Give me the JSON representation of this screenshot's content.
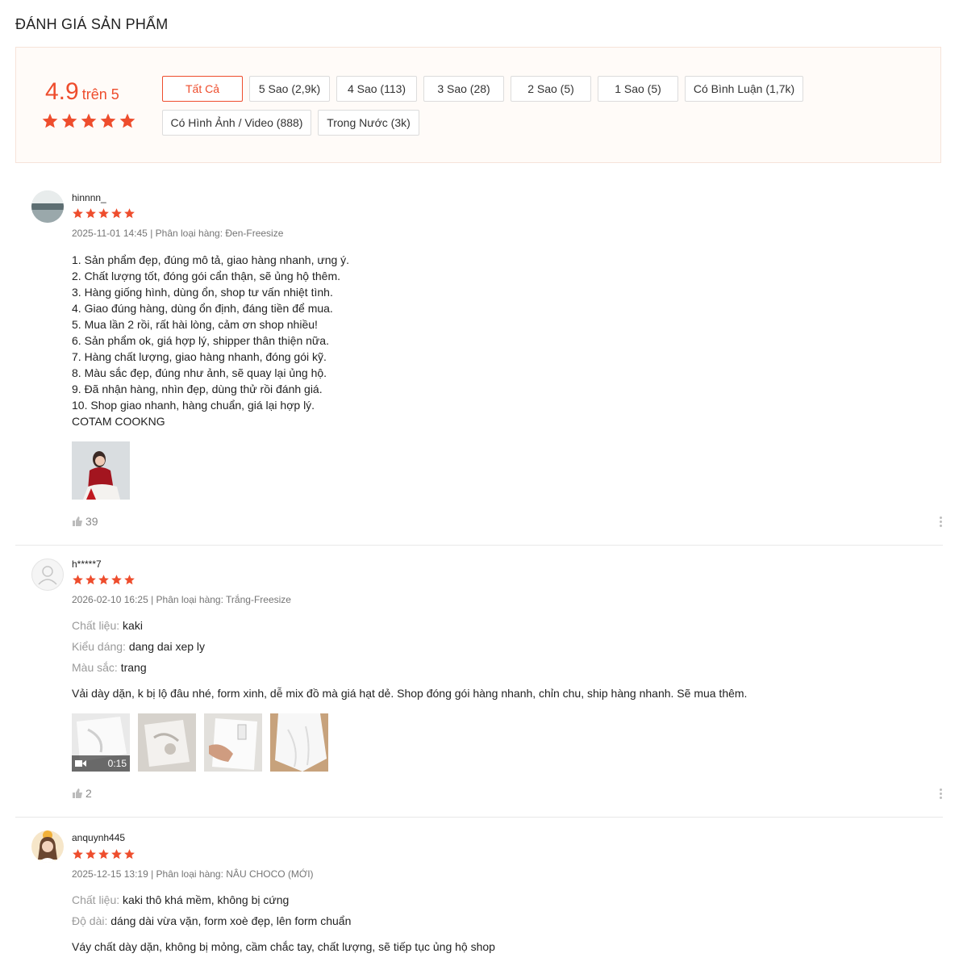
{
  "section_title": "ĐÁNH GIÁ SẢN PHẨM",
  "rating": {
    "score": "4.9",
    "out_of": "trên 5",
    "stars": 5
  },
  "colors": {
    "accent": "#ee4d2d",
    "summary_bg": "#fffbf8"
  },
  "filters": [
    {
      "label": "Tất Cả",
      "active": true
    },
    {
      "label": "5 Sao (2,9k)"
    },
    {
      "label": "4 Sao (113)"
    },
    {
      "label": "3 Sao (28)"
    },
    {
      "label": "2 Sao (5)"
    },
    {
      "label": "1 Sao (5)"
    },
    {
      "label": "Có Bình Luận (1,7k)"
    },
    {
      "label": "Có Hình Ảnh / Video (888)"
    },
    {
      "label": "Trong Nước (3k)"
    }
  ],
  "reviews": [
    {
      "username": "hinnnn_",
      "stars": 5,
      "meta": "2025-11-01 14:45 | Phân loại hàng: Đen-Freesize",
      "lines": [
        "1. Sản phẩm đẹp, đúng mô tả, giao hàng nhanh, ưng ý.",
        "2. Chất lượng tốt, đóng gói cẩn thận, sẽ ủng hộ thêm.",
        "3. Hàng giống hình, dùng ổn, shop tư vấn nhiệt tình.",
        "4. Giao đúng hàng, dùng ổn định, đáng tiền để mua.",
        "5. Mua lần 2 rồi, rất hài lòng, cảm ơn shop nhiều!",
        "6. Sản phẩm ok, giá hợp lý, shipper thân thiện nữa.",
        "7. Hàng chất lượng, giao hàng nhanh, đóng gói kỹ.",
        "8. Màu sắc đẹp, đúng như ảnh, sẽ quay lại ủng hộ.",
        "9. Đã nhận hàng, nhìn đẹp, dùng thử rồi đánh giá.",
        "10. Shop giao nhanh, hàng chuẩn, giá lại hợp lý.",
        "COTAM COOKNG"
      ],
      "likes": "39"
    },
    {
      "username": "h*****7",
      "stars": 5,
      "meta": "2026-02-10 16:25 | Phân loại hàng: Trắng-Freesize",
      "attributes": [
        {
          "key": "Chất liệu:",
          "value": "kaki"
        },
        {
          "key": "Kiểu dáng:",
          "value": "dang dai xep ly"
        },
        {
          "key": "Màu sắc:",
          "value": "trang"
        }
      ],
      "text": "Vải dày dặn, k bị lộ đâu nhé, form xinh, dễ mix đồ mà giá hạt dẻ. Shop đóng gói hàng nhanh, chỉn chu, ship hàng nhanh. Sẽ mua thêm.",
      "video_duration": "0:15",
      "likes": "2"
    },
    {
      "username": "anquynh445",
      "stars": 5,
      "meta": "2025-12-15 13:19 | Phân loại hàng: NÂU CHOCO (MỚI)",
      "attributes": [
        {
          "key": "Chất liệu:",
          "value": "kaki thô khá mềm, không bị cứng"
        },
        {
          "key": "Độ dài:",
          "value": "dáng dài vừa vặn, form xoè đẹp, lên form chuẩn"
        }
      ],
      "text": "Váy chất dày dặn, không bị mỏng, cầm chắc tay, chất lượng, sẽ tiếp tục ủng hộ shop"
    }
  ]
}
